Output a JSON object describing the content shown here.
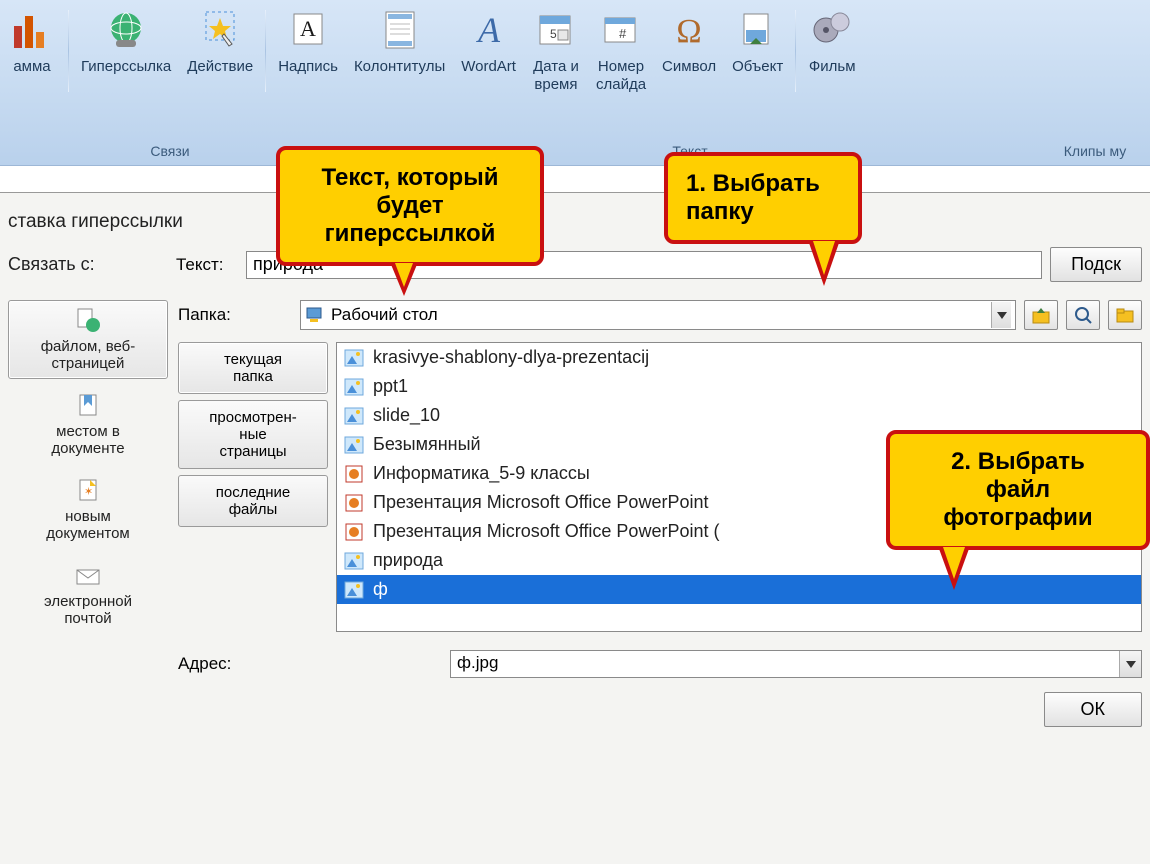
{
  "ribbon": {
    "items": [
      {
        "label": "амма"
      },
      {
        "label": "Гиперссылка"
      },
      {
        "label": "Действие"
      },
      {
        "label": "Надпись"
      },
      {
        "label": "Колонтитулы"
      },
      {
        "label": "WordArt"
      },
      {
        "label": "Дата и\nвремя"
      },
      {
        "label": "Номер\nслайда"
      },
      {
        "label": "Символ"
      },
      {
        "label": "Объект"
      },
      {
        "label": "Фильм"
      }
    ],
    "groups": {
      "links": "Связи",
      "text": "Текст",
      "media": "Клипы му"
    }
  },
  "dialog": {
    "title": "ставка гиперссылки",
    "link_label": "Связать с:",
    "text_label": "Текст:",
    "text_value": "природа",
    "hint_btn": "Подск",
    "folder_label": "Папка:",
    "folder_value": "Рабочий стол",
    "address_label": "Адрес:",
    "address_value": "ф.jpg",
    "ok": "ОК",
    "link_targets": [
      {
        "label": "файлом, веб-\nстраницей",
        "sel": true
      },
      {
        "label": "местом в\nдокументе"
      },
      {
        "label": "новым\nдокументом"
      },
      {
        "label": "электронной\nпочтой"
      }
    ],
    "views": [
      {
        "label": "текущая\nпапка",
        "sel": true
      },
      {
        "label": "просмотрен-\nные\nстраницы"
      },
      {
        "label": "последние\nфайлы"
      }
    ],
    "files": [
      {
        "name": "krasivye-shablony-dlya-prezentacij",
        "type": "img"
      },
      {
        "name": "ppt1",
        "type": "img"
      },
      {
        "name": "slide_10",
        "type": "img"
      },
      {
        "name": "Безымянный",
        "type": "img"
      },
      {
        "name": "Информатика_5-9 классы",
        "type": "ppt"
      },
      {
        "name": "Презентация Microsoft Office PowerPoint",
        "type": "ppt"
      },
      {
        "name": "Презентация Microsoft Office PowerPoint (",
        "type": "ppt"
      },
      {
        "name": "природа",
        "type": "img"
      },
      {
        "name": "ф",
        "type": "img",
        "sel": true
      }
    ]
  },
  "callouts": {
    "c1": "Текст, который\nбудет\nгиперссылкой",
    "c2": "1. Выбрать\nпапку",
    "c3": "2. Выбрать\nфайл\nфотографии"
  }
}
